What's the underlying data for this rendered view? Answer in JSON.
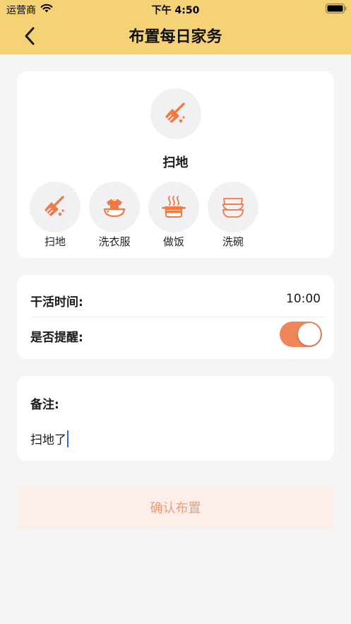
{
  "status_bar": {
    "carrier": "运营商",
    "time": "下午 4:50"
  },
  "header": {
    "title": "布置每日家务"
  },
  "selected_task": {
    "label": "扫地",
    "icon": "broom-icon"
  },
  "task_options": [
    {
      "label": "扫地",
      "icon": "broom-icon"
    },
    {
      "label": "洗衣服",
      "icon": "laundry-icon"
    },
    {
      "label": "做饭",
      "icon": "cooking-pot-icon"
    },
    {
      "label": "洗碗",
      "icon": "bowls-icon"
    }
  ],
  "settings": {
    "work_time_label": "干活时间:",
    "work_time_value": "10:00",
    "reminder_label": "是否提醒:",
    "reminder_enabled": true
  },
  "notes": {
    "label": "备注:",
    "value": "扫地了"
  },
  "confirm_button": {
    "label": "确认布置"
  },
  "colors": {
    "header_bg": "#f5d276",
    "accent": "#ee8659",
    "icon_orange": "#ef7a45",
    "confirm_bg": "#fcefea",
    "confirm_text": "#f29a73"
  }
}
